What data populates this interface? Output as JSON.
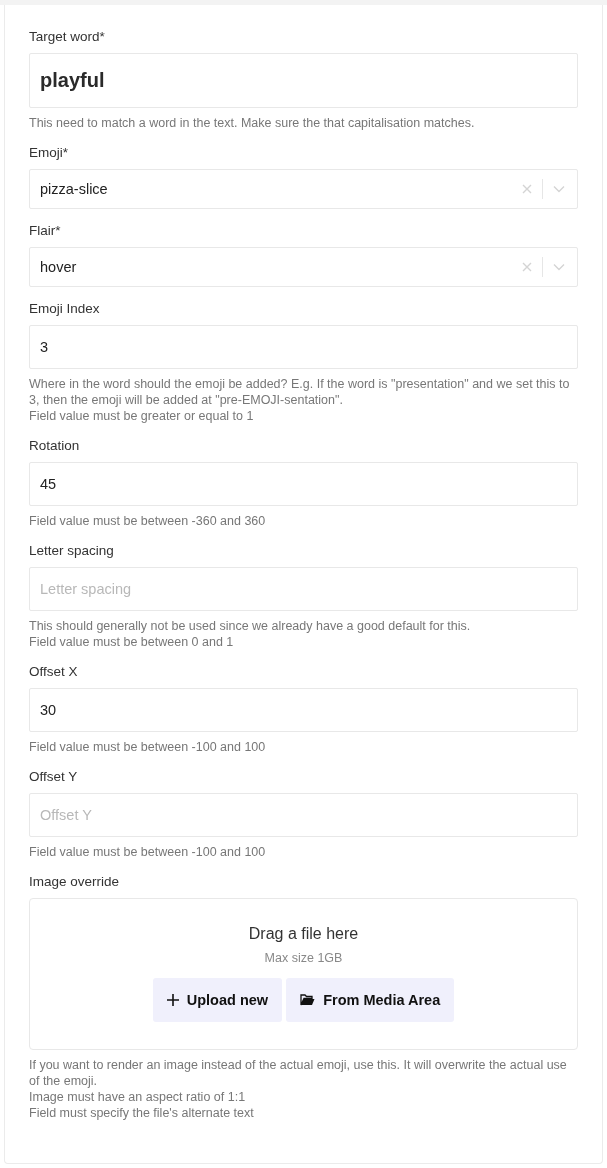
{
  "fields": [
    {
      "kind": "large",
      "label": "Target word*",
      "value": "playful",
      "help": [
        "This need to match a word in the text. Make sure the that capitalisation matches."
      ]
    },
    {
      "kind": "select",
      "label": "Emoji*",
      "value": "pizza-slice"
    },
    {
      "kind": "select",
      "label": "Flair*",
      "value": "hover"
    },
    {
      "kind": "text",
      "label": "Emoji Index",
      "value": "3",
      "help": [
        "Where in the word should the emoji be added? E.g. If the word is \"presentation\" and we set this to 3, then the emoji will be added at \"pre-EMOJI-sentation\".",
        "Field value must be greater or equal to 1"
      ]
    },
    {
      "kind": "text",
      "label": "Rotation",
      "value": "45",
      "help": [
        "Field value must be between -360 and 360"
      ]
    },
    {
      "kind": "text",
      "label": "Letter spacing",
      "placeholder": "Letter spacing",
      "help": [
        "This should generally not be used since we already have a good default for this.",
        "Field value must be between 0 and 1"
      ]
    },
    {
      "kind": "text",
      "label": "Offset X",
      "value": "30",
      "help": [
        "Field value must be between -100 and 100"
      ]
    },
    {
      "kind": "text",
      "label": "Offset Y",
      "placeholder": "Offset Y",
      "help": [
        "Field value must be between -100 and 100"
      ]
    },
    {
      "kind": "file",
      "label": "Image override",
      "drop_title": "Drag a file here",
      "drop_hint": "Max size 1GB",
      "buttons": [
        {
          "kind": "upload",
          "label": "Upload new"
        },
        {
          "kind": "media",
          "label": "From Media Area"
        }
      ],
      "help": [
        "If you want to render an image instead of the actual emoji, use this. It will overwrite the actual use of the emoji.",
        "Image must have an aspect ratio of 1:1",
        "Field must specify the file's alternate text"
      ]
    }
  ]
}
